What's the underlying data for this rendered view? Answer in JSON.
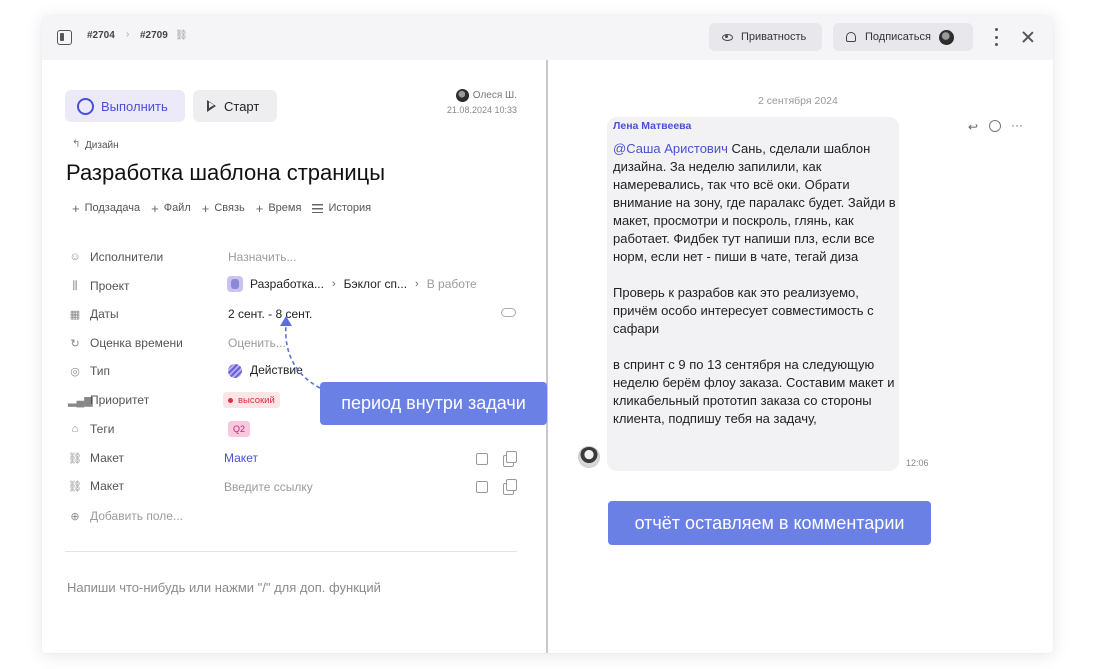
{
  "header": {
    "crumb_parent": "#2704",
    "crumb_current": "#2709",
    "privacy_label": "Приватность",
    "subscribe_label": "Подписаться"
  },
  "task": {
    "complete_label": "Выполнить",
    "start_label": "Старт",
    "author_name": "Олеся Ш.",
    "created_at": "21.08.2024 10:33",
    "parent": "Дизайн",
    "title": "Разработка шаблона страницы",
    "actions": [
      "Подзадача",
      "Файл",
      "Связь",
      "Время",
      "История"
    ]
  },
  "properties": {
    "assignees_label": "Исполнители",
    "assignees_value": "Назначить...",
    "project_label": "Проект",
    "project_name": "Разработка...",
    "project_board": "Бэклог сп...",
    "project_status": "В работе",
    "dates_label": "Даты",
    "dates_value": "2 сент. - 8 сент.",
    "estimate_label": "Оценка времени",
    "estimate_value": "Оценить...",
    "type_label": "Тип",
    "type_value": "Действие",
    "priority_label": "Приоритет",
    "priority_value": "высокий",
    "tags_label": "Теги",
    "tag_value": "Q2",
    "mockup1_label": "Макет",
    "mockup1_value": "Макет",
    "mockup2_label": "Макет",
    "mockup2_placeholder": "Введите ссылку",
    "add_field": "Добавить поле..."
  },
  "composer": {
    "placeholder": "Напиши что-нибудь или нажми \"/\" для доп. функций"
  },
  "annotations": {
    "period": "период внутри задачи",
    "report": "отчёт оставляем в комментарии"
  },
  "chat": {
    "date": "2 сентября 2024",
    "author": "Лена Матвеева",
    "mention": "@Саша Аристович",
    "text": " Сань, сделали шаблон дизайна. За неделю запилили, как намеревались, так что всё оки. Обрати внимание на зону, где паралакс будет. Зайди в макет, просмотри и поскроль, глянь, как работает. Фидбек тут напиши плз, если все норм, если нет - пиши в чате, тегай диза\n\nПроверь к разрабов как это реализуемо, причём особо интересует совместимость с сафари\n\nв спринт с 9 по 13 сентября на следующую неделю берём флоу заказа. Составим макет и кликабельный прототип заказа со стороны клиента, подпишу тебя на задачу,",
    "time": "12:06"
  },
  "colors": {
    "accent": "#4a4fd6",
    "callout": "#6b80e4",
    "priority_high": "#d6303f"
  }
}
